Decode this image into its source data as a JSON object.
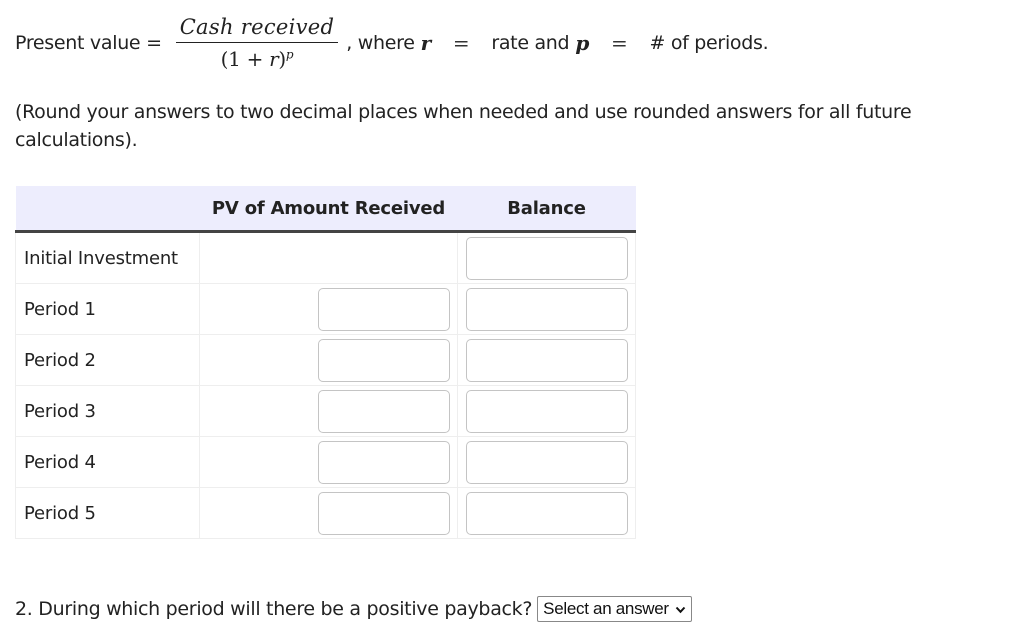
{
  "formula": {
    "label": "Present value =",
    "numerator": "Cash received",
    "denominator_base": "(1 + ",
    "denominator_var": "r",
    "denominator_close": ")",
    "denominator_exponent": "p",
    "where_text": ", where",
    "var_r": "r",
    "equals": "=",
    "r_meaning": "rate and",
    "var_p": "p",
    "p_meaning": "# of periods."
  },
  "instructions": "(Round your answers to two decimal places when needed and use rounded answers for all future calculations).",
  "table": {
    "headers": [
      "",
      "PV of Amount Received",
      "Balance"
    ],
    "rows": [
      {
        "label": "Initial Investment",
        "pv_input": null,
        "balance_value": ""
      },
      {
        "label": "Period 1",
        "pv_value": "",
        "balance_value": ""
      },
      {
        "label": "Period 2",
        "pv_value": "",
        "balance_value": ""
      },
      {
        "label": "Period 3",
        "pv_value": "",
        "balance_value": ""
      },
      {
        "label": "Period 4",
        "pv_value": "",
        "balance_value": ""
      },
      {
        "label": "Period 5",
        "pv_value": "",
        "balance_value": ""
      }
    ]
  },
  "question": {
    "text": "2. During which period will there be a positive payback?",
    "select_value": "Select an answer",
    "select_icon": "chevron-down-icon"
  }
}
